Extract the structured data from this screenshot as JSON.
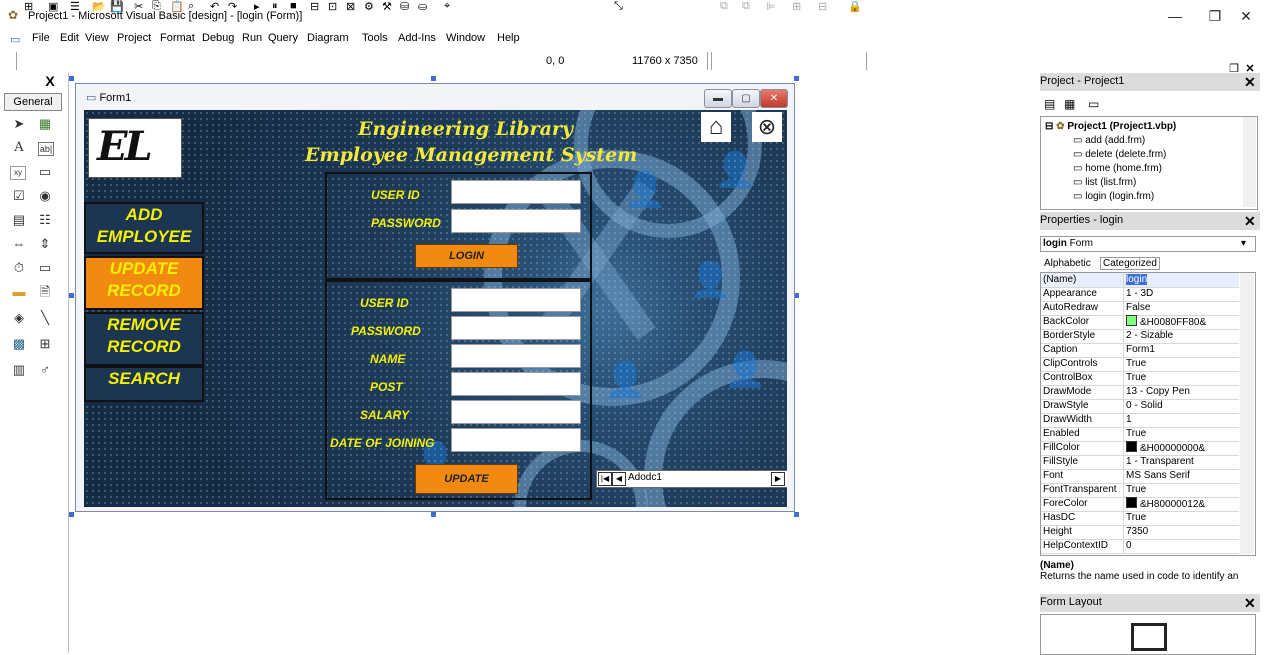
{
  "window": {
    "title": "Project1 - Microsoft Visual Basic [design] - [login (Form)]",
    "controls": {
      "minimize": "—",
      "restore": "❐",
      "close": "✕"
    },
    "mdi_controls": {
      "minimize": "_",
      "restore": "❐",
      "close": "✕"
    }
  },
  "menu": [
    "File",
    "Edit",
    "View",
    "Project",
    "Format",
    "Debug",
    "Run",
    "Query",
    "Diagram",
    "Tools",
    "Add-Ins",
    "Window",
    "Help"
  ],
  "toolbar": {
    "position_readout": "0, 0",
    "size_readout": "11760 x 7350"
  },
  "toolbox": {
    "title": "General",
    "close": "X"
  },
  "form": {
    "caption": "Form1",
    "heading_line1": "Engineering Library",
    "heading_line2": "Employee Management System",
    "logo_text": "EL",
    "nav": {
      "add": "ADD\nEMPLOYEE",
      "update": "UPDATE\nRECORD",
      "remove": "REMOVE\nRECORD",
      "search": "SEARCH"
    },
    "login": {
      "user_id_label": "USER ID",
      "password_label": "PASSWORD",
      "button": "LOGIN"
    },
    "update": {
      "user_id_label": "USER ID",
      "password_label": "PASSWORD",
      "name_label": "NAME",
      "post_label": "POST",
      "salary_label": "SALARY",
      "doj_label": "DATE OF JOINING",
      "button": "UPDATE"
    },
    "adodc": {
      "label": "Adodc1"
    }
  },
  "project_explorer": {
    "title": "Project - Project1",
    "root": "Project1 (Project1.vbp)",
    "items": [
      "add (add.frm)",
      "delete (delete.frm)",
      "home (home.frm)",
      "list (list.frm)",
      "login (login.frm)"
    ]
  },
  "properties": {
    "title": "Properties - login",
    "object_name": "login",
    "object_type": "Form",
    "tabs": [
      "Alphabetic",
      "Categorized"
    ],
    "rows": [
      {
        "name": "(Name)",
        "value": "login"
      },
      {
        "name": "Appearance",
        "value": "1 - 3D"
      },
      {
        "name": "AutoRedraw",
        "value": "False"
      },
      {
        "name": "BackColor",
        "value": "&H0080FF80&",
        "swatch": "#80ff80"
      },
      {
        "name": "BorderStyle",
        "value": "2 - Sizable"
      },
      {
        "name": "Caption",
        "value": "Form1"
      },
      {
        "name": "ClipControls",
        "value": "True"
      },
      {
        "name": "ControlBox",
        "value": "True"
      },
      {
        "name": "DrawMode",
        "value": "13 - Copy Pen"
      },
      {
        "name": "DrawStyle",
        "value": "0 - Solid"
      },
      {
        "name": "DrawWidth",
        "value": "1"
      },
      {
        "name": "Enabled",
        "value": "True"
      },
      {
        "name": "FillColor",
        "value": "&H00000000&",
        "swatch": "#000000"
      },
      {
        "name": "FillStyle",
        "value": "1 - Transparent"
      },
      {
        "name": "Font",
        "value": "MS Sans Serif"
      },
      {
        "name": "FontTransparent",
        "value": "True"
      },
      {
        "name": "ForeColor",
        "value": "&H80000012&",
        "swatch": "#000000"
      },
      {
        "name": "HasDC",
        "value": "True"
      },
      {
        "name": "Height",
        "value": "7350"
      },
      {
        "name": "HelpContextID",
        "value": "0"
      }
    ],
    "desc_title": "(Name)",
    "desc_text": "Returns the name used in code to identify an"
  },
  "form_layout": {
    "title": "Form Layout"
  }
}
